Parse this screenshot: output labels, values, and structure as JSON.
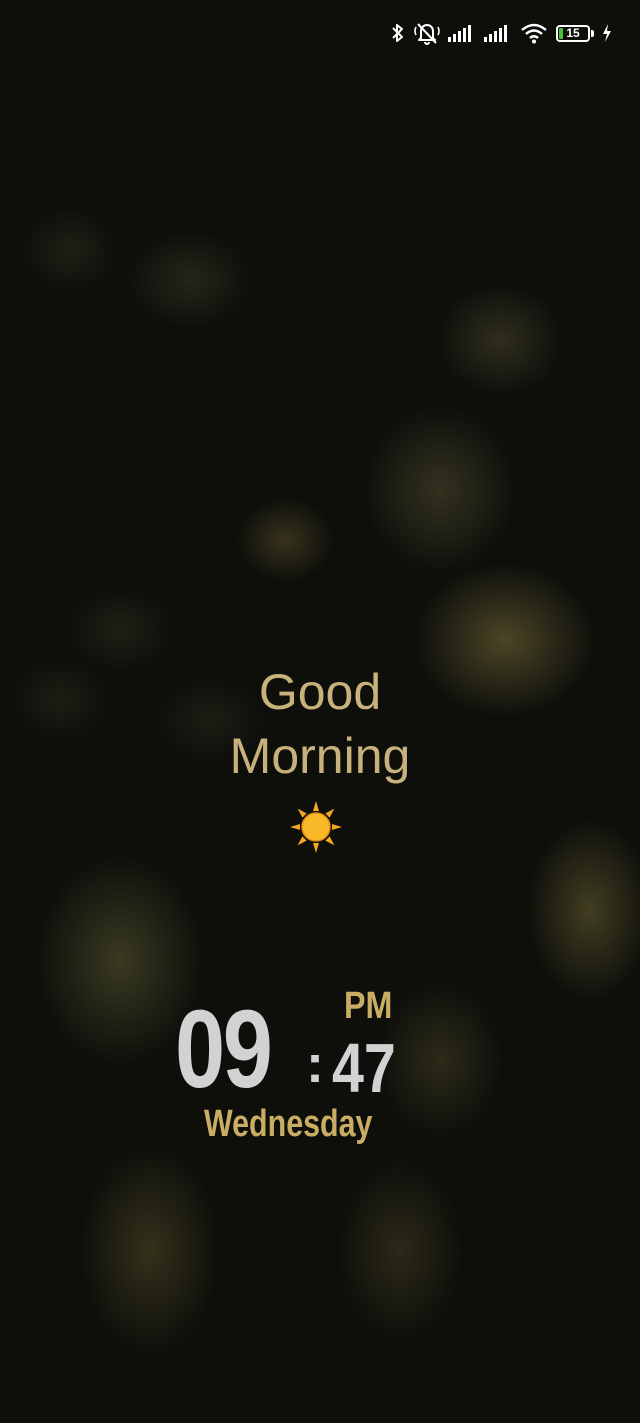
{
  "status_bar": {
    "icons": [
      "bluetooth-icon",
      "muted-bell-icon",
      "signal-icon",
      "signal-icon",
      "wifi-icon",
      "charging-bolt-icon"
    ],
    "battery_level": "15",
    "battery_fraction": 0.15,
    "battery_fill_color": "#44c23b"
  },
  "greeting": {
    "line1": "Good",
    "line2": "Morning",
    "icon": "sun-icon",
    "color": "#c8b27c"
  },
  "clock": {
    "hour": "09",
    "separator": ":",
    "minute": "47",
    "ampm": "PM",
    "weekday": "Wednesday",
    "digit_color": "#d2d2d2",
    "accent_color": "#c9ad62"
  }
}
